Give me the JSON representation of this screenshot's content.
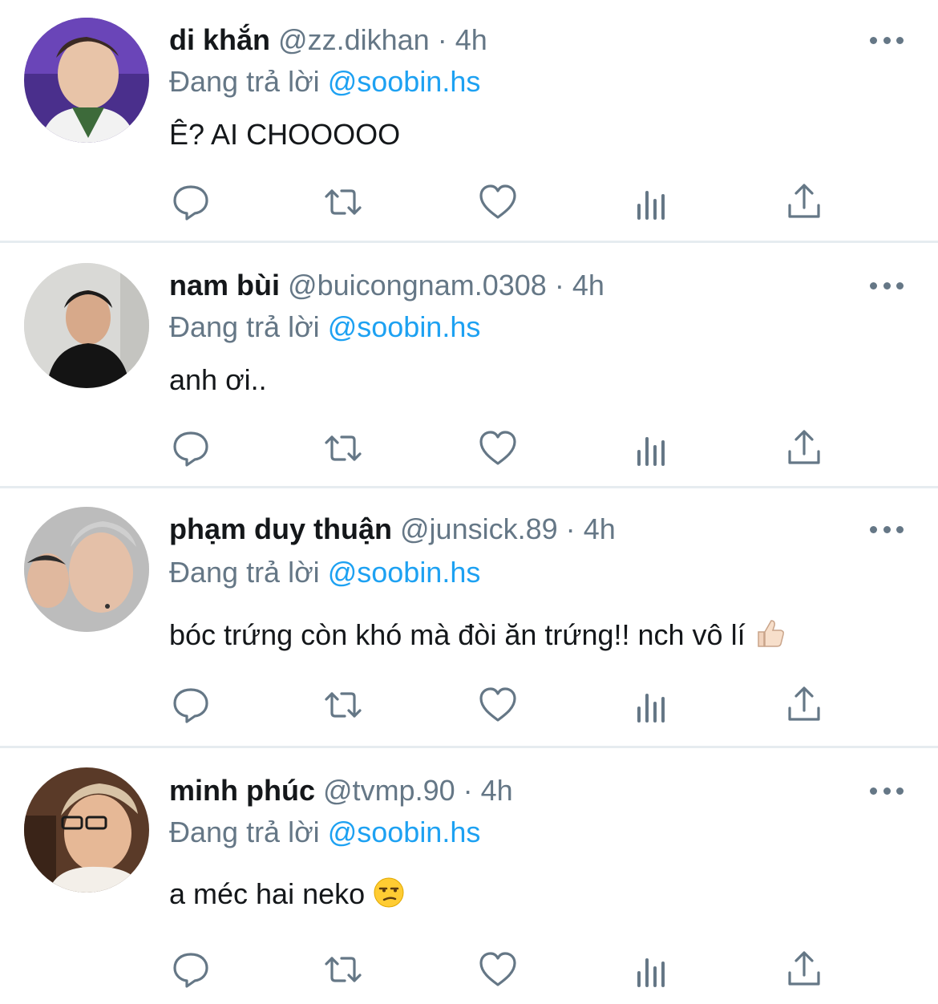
{
  "colors": {
    "name": "#14171a",
    "secondary": "#657786",
    "mention": "#1da1f2",
    "divider": "#e6ecf0"
  },
  "icons": [
    "reply-icon",
    "retweet-icon",
    "like-icon",
    "views-icon",
    "share-icon",
    "more-icon"
  ],
  "tweets": [
    {
      "name": "di khắn",
      "handle": "@zz.dikhan",
      "dot": "·",
      "time": "4h",
      "reply_prefix": "Đang trả lời",
      "reply_to": "@soobin.hs",
      "text": "Ê? AI CHOOOOO"
    },
    {
      "name": "nam bùi",
      "handle": "@buicongnam.0308",
      "dot": "·",
      "time": "4h",
      "reply_prefix": "Đang trả lời",
      "reply_to": "@soobin.hs",
      "text": "anh ơi.."
    },
    {
      "name": "phạm duy thuận",
      "handle": "@junsick.89",
      "dot": "·",
      "time": "4h",
      "reply_prefix": "Đang trả lời",
      "reply_to": "@soobin.hs",
      "text": "bóc trứng còn khó mà đòi ăn trứng!! nch vô lí",
      "emoji": "thumbs-up"
    },
    {
      "name": "minh phúc",
      "handle": "@tvmp.90",
      "dot": "·",
      "time": "4h",
      "reply_prefix": "Đang trả lời",
      "reply_to": "@soobin.hs",
      "text": "a méc hai neko",
      "emoji": "unamused-face"
    }
  ]
}
